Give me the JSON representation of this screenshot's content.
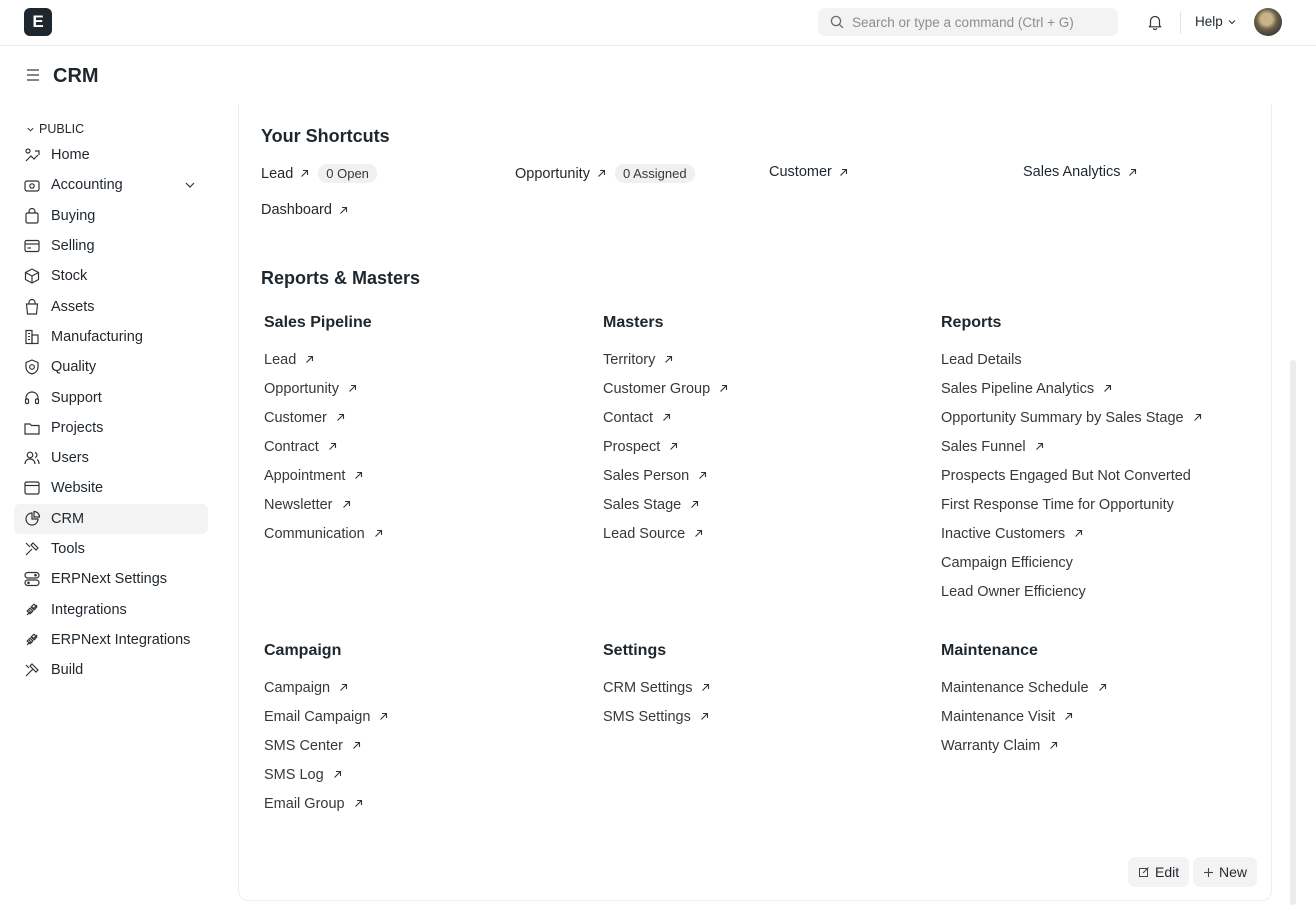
{
  "navbar": {
    "logo": "E",
    "search_placeholder": "Search or type a command (Ctrl + G)",
    "help_label": "Help"
  },
  "page": {
    "title": "CRM"
  },
  "sidebar": {
    "section_label": "PUBLIC",
    "items": [
      {
        "label": "Home",
        "icon": "home-icon"
      },
      {
        "label": "Accounting",
        "icon": "accounting-icon"
      },
      {
        "label": "Buying",
        "icon": "buying-icon"
      },
      {
        "label": "Selling",
        "icon": "selling-icon"
      },
      {
        "label": "Stock",
        "icon": "stock-icon"
      },
      {
        "label": "Assets",
        "icon": "assets-icon"
      },
      {
        "label": "Manufacturing",
        "icon": "manufacturing-icon"
      },
      {
        "label": "Quality",
        "icon": "quality-icon"
      },
      {
        "label": "Support",
        "icon": "support-icon"
      },
      {
        "label": "Projects",
        "icon": "projects-icon"
      },
      {
        "label": "Users",
        "icon": "users-icon"
      },
      {
        "label": "Website",
        "icon": "website-icon"
      },
      {
        "label": "CRM",
        "icon": "crm-icon"
      },
      {
        "label": "Tools",
        "icon": "tools-icon"
      },
      {
        "label": "ERPNext Settings",
        "icon": "settings-icon"
      },
      {
        "label": "Integrations",
        "icon": "integrations-icon"
      },
      {
        "label": "ERPNext Integrations",
        "icon": "integrations-icon"
      },
      {
        "label": "Build",
        "icon": "build-icon"
      }
    ]
  },
  "shortcuts": {
    "title": "Your Shortcuts",
    "items": [
      {
        "label": "Lead",
        "pill": "0 Open"
      },
      {
        "label": "Opportunity",
        "pill": "0 Assigned"
      },
      {
        "label": "Customer"
      },
      {
        "label": "Sales Analytics"
      },
      {
        "label": "Dashboard"
      }
    ]
  },
  "reports_masters": {
    "title": "Reports & Masters",
    "sections": [
      {
        "title": "Sales Pipeline",
        "links": [
          {
            "label": "Lead",
            "arrow": true
          },
          {
            "label": "Opportunity",
            "arrow": true
          },
          {
            "label": "Customer",
            "arrow": true
          },
          {
            "label": "Contract",
            "arrow": true
          },
          {
            "label": "Appointment",
            "arrow": true
          },
          {
            "label": "Newsletter",
            "arrow": true
          },
          {
            "label": "Communication",
            "arrow": true
          }
        ]
      },
      {
        "title": "Masters",
        "links": [
          {
            "label": "Territory",
            "arrow": true
          },
          {
            "label": "Customer Group",
            "arrow": true
          },
          {
            "label": "Contact",
            "arrow": true
          },
          {
            "label": "Prospect",
            "arrow": true
          },
          {
            "label": "Sales Person",
            "arrow": true
          },
          {
            "label": "Sales Stage",
            "arrow": true
          },
          {
            "label": "Lead Source",
            "arrow": true
          }
        ]
      },
      {
        "title": "Reports",
        "links": [
          {
            "label": "Lead Details",
            "arrow": false
          },
          {
            "label": "Sales Pipeline Analytics",
            "arrow": true
          },
          {
            "label": "Opportunity Summary by Sales Stage",
            "arrow": true
          },
          {
            "label": "Sales Funnel",
            "arrow": true
          },
          {
            "label": "Prospects Engaged But Not Converted",
            "arrow": false
          },
          {
            "label": "First Response Time for Opportunity",
            "arrow": false
          },
          {
            "label": "Inactive Customers",
            "arrow": true
          },
          {
            "label": "Campaign Efficiency",
            "arrow": false
          },
          {
            "label": "Lead Owner Efficiency",
            "arrow": false
          }
        ]
      },
      {
        "title": "Campaign",
        "links": [
          {
            "label": "Campaign",
            "arrow": true
          },
          {
            "label": "Email Campaign",
            "arrow": true
          },
          {
            "label": "SMS Center",
            "arrow": true
          },
          {
            "label": "SMS Log",
            "arrow": true
          },
          {
            "label": "Email Group",
            "arrow": true
          }
        ]
      },
      {
        "title": "Settings",
        "links": [
          {
            "label": "CRM Settings",
            "arrow": true
          },
          {
            "label": "SMS Settings",
            "arrow": true
          }
        ]
      },
      {
        "title": "Maintenance",
        "links": [
          {
            "label": "Maintenance Schedule",
            "arrow": true
          },
          {
            "label": "Maintenance Visit",
            "arrow": true
          },
          {
            "label": "Warranty Claim",
            "arrow": true
          }
        ]
      }
    ]
  },
  "actions": {
    "edit_label": "Edit",
    "new_label": "New"
  }
}
